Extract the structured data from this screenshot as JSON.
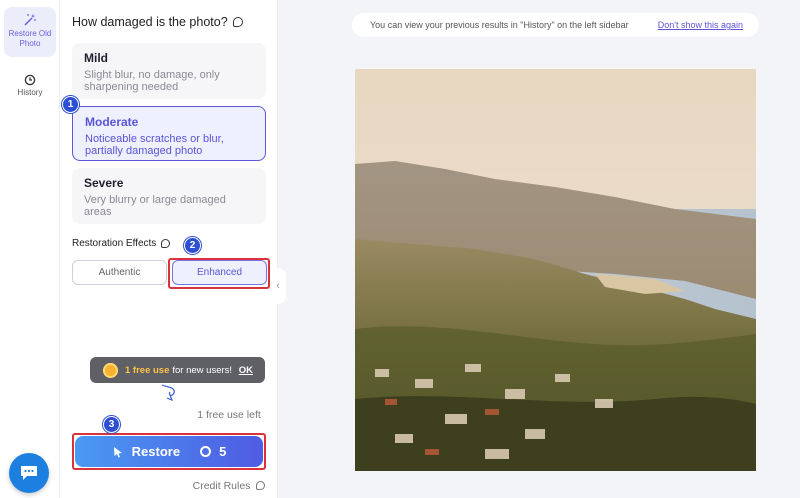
{
  "rail": {
    "items": [
      {
        "label": "Restore Old Photo",
        "icon": "magic-wand-icon",
        "active": true
      },
      {
        "label": "History",
        "icon": "clock-icon",
        "active": false
      }
    ]
  },
  "panel": {
    "title": "How damaged is the photo?",
    "options": [
      {
        "name": "Mild",
        "desc": "Slight blur, no damage, only sharpening needed"
      },
      {
        "name": "Moderate",
        "desc": "Noticeable scratches or blur, partially damaged photo",
        "selected": true
      },
      {
        "name": "Severe",
        "desc": "Very blurry or large damaged areas"
      }
    ],
    "effects_label": "Restoration Effects",
    "effects": [
      {
        "label": "Authentic"
      },
      {
        "label": "Enhanced",
        "selected": true
      }
    ],
    "steps": [
      "1",
      "2",
      "3"
    ],
    "promo": {
      "highlight": "1 free use",
      "text": "for new users!",
      "ok": "OK"
    },
    "free_left": "1 free use left",
    "restore": {
      "label": "Restore",
      "cost": "5"
    },
    "credit_rules": "Credit Rules"
  },
  "main": {
    "notice": "You can view your previous results in \"History\" on the left sidebar",
    "dont_show": "Don't show this again"
  },
  "colors": {
    "accent": "#5b54d6",
    "highlight_box": "#d9323a",
    "step_badge": "#2d4fd1",
    "chat": "#1d7fe0"
  }
}
